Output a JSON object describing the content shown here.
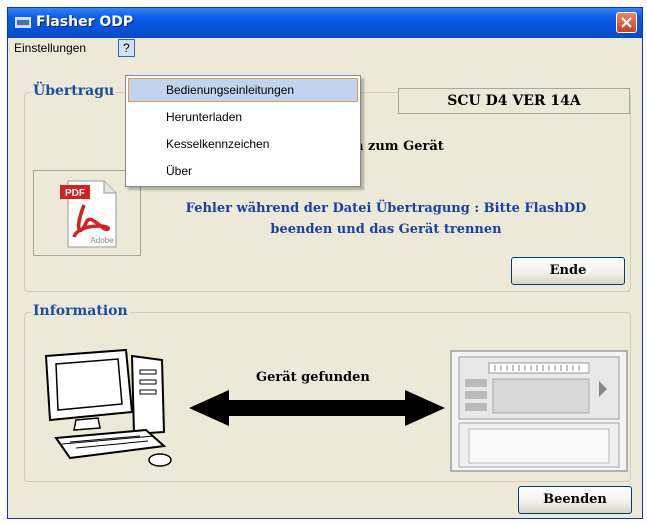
{
  "window": {
    "title": "Flasher ODP"
  },
  "menubar": {
    "settings_label": "Einstellungen",
    "help_label": "?"
  },
  "help_menu": {
    "items": [
      "Bedienungseinleitungen",
      "Herunterladen",
      "Kesselkennzeichen",
      "Über"
    ]
  },
  "transfer": {
    "group_title": "Übertragu",
    "version": "SCU D4 VER  14A",
    "status_partial": "n zum Gerät",
    "error_line1": "Fehler während der Datei Übertragung : Bitte FlashDD",
    "error_line2": "beenden und das Gerät trennen",
    "end_button": "Ende",
    "pdf_icon": "adobe-pdf-icon",
    "pdf_label_top": "PDF",
    "pdf_label_bottom": "Adobe"
  },
  "information": {
    "group_title": "Information",
    "status": "Gerät gefunden",
    "computer_icon": "computer-icon",
    "device_icon": "boiler-device-icon",
    "arrow_icon": "double-arrow-icon"
  },
  "footer": {
    "close_button": "Beenden"
  },
  "colors": {
    "titlebar": "#0553d8",
    "group_title": "#1c4da0",
    "error_text": "#1c3ea6",
    "menu_highlight": "#c2d3ef"
  }
}
